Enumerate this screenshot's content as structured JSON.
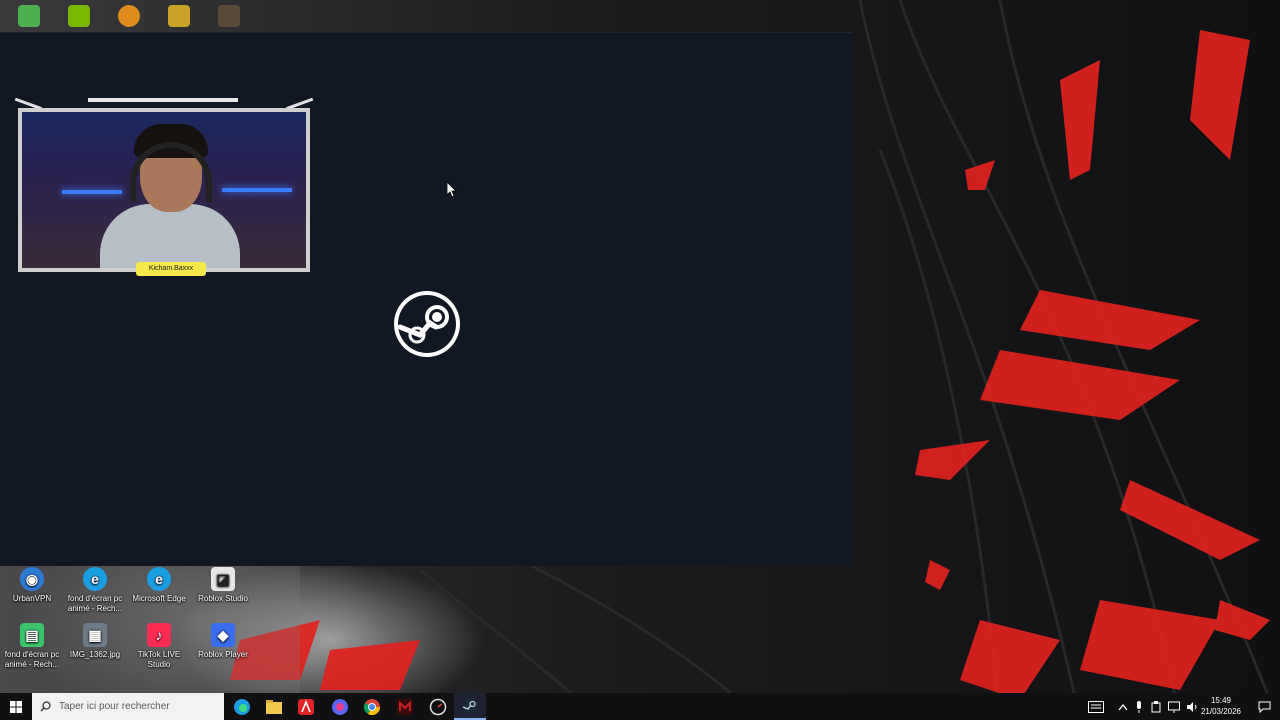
{
  "desktop": {
    "icons": [
      {
        "label": "UrbanVPN",
        "icon": "urbanvpn-icon",
        "color": "#2e7bd6"
      },
      {
        "label": "fond d'écran pc animé - Rech...",
        "icon": "edge-icon",
        "color": "#1b9de2"
      },
      {
        "label": "Microsoft Edge",
        "icon": "edge-icon",
        "color": "#1b9de2"
      },
      {
        "label": "Roblox Studio",
        "icon": "roblox-studio-icon",
        "color": "#e7e7e7"
      },
      {
        "label": "fond d'écran pc animé - Rech...",
        "icon": "document-icon",
        "color": "#3cc46a"
      },
      {
        "label": "IMG_1362.jpg",
        "icon": "image-file-icon",
        "color": "#6d7a88"
      },
      {
        "label": "TikTok LIVE Studio",
        "icon": "tiktok-icon",
        "color": "#fe2c55"
      },
      {
        "label": "Roblox Player",
        "icon": "roblox-player-icon",
        "color": "#3a6df0"
      }
    ]
  },
  "steam_window": {
    "logo": "steam-logo-icon",
    "background": "#111823"
  },
  "webcam": {
    "badge_text": "Kicham.Baxxx"
  },
  "taskbar": {
    "search_placeholder": "Taper ici pour rechercher",
    "apps": [
      {
        "icon": "edge-icon",
        "color": "#1b9de2"
      },
      {
        "icon": "file-explorer-icon",
        "color": "#f2c94c"
      },
      {
        "icon": "adobe-acrobat-icon",
        "color": "#e02424"
      },
      {
        "icon": "discord-like-icon",
        "color": "#5865f2"
      },
      {
        "icon": "chrome-icon",
        "color": "#fbbc04"
      },
      {
        "icon": "mcafee-icon",
        "color": "#c81e1e"
      },
      {
        "icon": "speedometer-icon",
        "color": "#e0e0e0"
      },
      {
        "icon": "steam-icon",
        "color": "#c7d5e0"
      }
    ],
    "clock": {
      "time": "15:49",
      "date": "21/03/2026"
    }
  }
}
